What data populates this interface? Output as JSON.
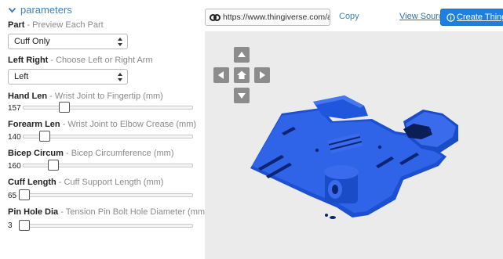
{
  "parameters": {
    "header": "parameters",
    "part": {
      "name": "Part",
      "desc": " - Preview Each Part",
      "value": "Cuff Only"
    },
    "left_right": {
      "name": "Left Right",
      "desc": " - Choose Left or Right Arm",
      "value": "Left"
    },
    "hand_len": {
      "name": "Hand Len",
      "desc": " - Wrist Joint to Fingertip (mm)",
      "value": "157",
      "fraction": 0.31
    },
    "forearm_len": {
      "name": "Forearm Len",
      "desc": " - Wrist Joint to Elbow Crease (mm)",
      "value": "140",
      "fraction": 0.11
    },
    "bicep_circum": {
      "name": "Bicep Circum",
      "desc": " - Bicep Circumference (mm)",
      "value": "160",
      "fraction": 0.2
    },
    "cuff_length": {
      "name": "Cuff Length",
      "desc": " - Cuff Support Length (mm)",
      "value": "65",
      "fraction": 0.0
    },
    "pin_hole_dia": {
      "name": "Pin Hole Dia",
      "desc": " - Tension Pin Bolt Hole Diameter (mm)",
      "value": "3",
      "fraction": 0.0
    }
  },
  "toolbar": {
    "url": "https://www.thingiverse.com/ap",
    "copy_label": "Copy",
    "view_source_label": "View Source",
    "create_label": "Create Thing"
  },
  "colors": {
    "accent": "#1f7fe0",
    "link": "#3a83c4",
    "model": "#1c50d0",
    "viewer_bg": "#ebebeb"
  },
  "icons": {
    "section_toggle": "chevron-down-icon",
    "link": "link-icon",
    "create": "info-circle-icon",
    "nav": [
      "arrow-up-icon",
      "arrow-left-icon",
      "home-icon",
      "arrow-right-icon",
      "arrow-down-icon"
    ]
  }
}
